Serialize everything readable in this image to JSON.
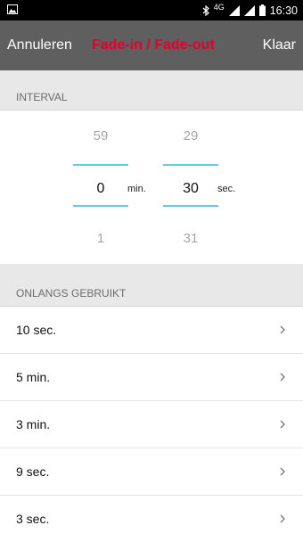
{
  "status_bar": {
    "network": "4G",
    "time": "16:30",
    "icons": [
      "image-icon",
      "bluetooth-icon",
      "signal-icon",
      "signal-icon",
      "battery-icon"
    ]
  },
  "action_bar": {
    "cancel_label": "Annuleren",
    "title": "Fade-in / Fade-out",
    "done_label": "Klaar",
    "title_color": "#e4002b",
    "background_color": "#5f5f5f"
  },
  "interval": {
    "header": "INTERVAL",
    "minutes": {
      "above": "59",
      "selected": "0",
      "below": "1",
      "unit": "min."
    },
    "seconds": {
      "above": "29",
      "selected": "30",
      "below": "31",
      "unit": "sec."
    },
    "accent_color": "#66c8ec"
  },
  "recent": {
    "header": "ONLANGS GEBRUIKT",
    "items": [
      {
        "label": "10 sec."
      },
      {
        "label": "5 min."
      },
      {
        "label": "3 min."
      },
      {
        "label": "9 sec."
      },
      {
        "label": "3 sec."
      }
    ]
  }
}
